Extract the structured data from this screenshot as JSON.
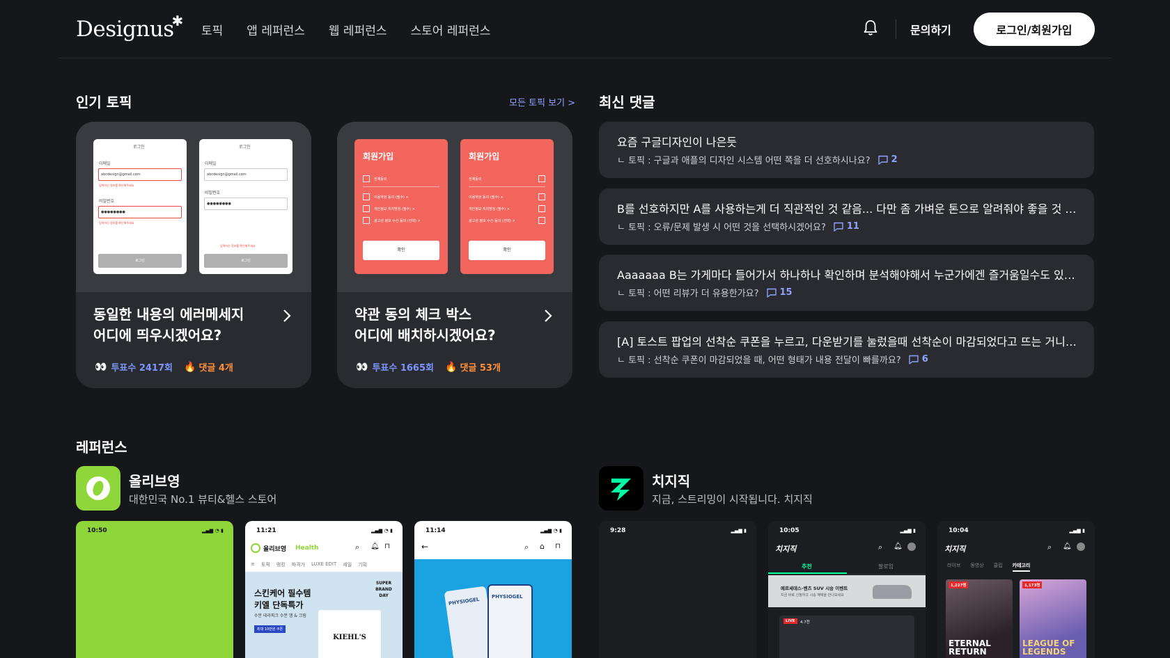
{
  "header": {
    "logo": "Designus",
    "nav": [
      "토픽",
      "앱 레퍼런스",
      "웹 레퍼런스",
      "스토어 레퍼런스"
    ],
    "inquiry": "문의하기",
    "login": "로그인/회원가입"
  },
  "popular": {
    "title": "인기 토픽",
    "see_all": "모든 토픽 보기 >",
    "cards": [
      {
        "title_line1": "동일한 내용의 에러메세지",
        "title_line2": "어디에 띄우시겠어요?",
        "votes": "투표수 2417회",
        "comments": "댓글 4개",
        "mock": {
          "header": "로그인",
          "email_label": "이메일",
          "email_value": "abcdesign@gmail.com",
          "error1": "입력하신 정보를 확인해주세요",
          "pw_label": "비밀번호",
          "pw_value": "●●●●●●●●",
          "error2": "입력하신 정보를 확인해주세요",
          "button": "로그인"
        }
      },
      {
        "title_line1": "약관 동의 체크 박스",
        "title_line2": "어디에 배치하시겠어요?",
        "votes": "투표수 1665회",
        "comments": "댓글 53개",
        "mock": {
          "header": "회원가입",
          "all": "전체동의",
          "item1": "이용약관 동의 (필수) >",
          "item2": "개인정보 처리방침 (필수) >",
          "item3": "광고성 정보 수신 동의 (선택) >",
          "button": "확인"
        }
      }
    ]
  },
  "comments": {
    "title": "최신 댓글",
    "items": [
      {
        "text": "요즘 구글디자인이 나은듯",
        "topic": "ㄴ 토픽 : 구글과 애플의 디자인 시스템 어떤 쪽을 더 선호하시나요?",
        "count": "2"
      },
      {
        "text": "B를 선호하지만 A를 사용하는게 더 직관적인 것 같음... 다만 좀 가벼운 톤으로 알려줘야 좋을 것 같음",
        "topic": "ㄴ 토픽 : 오류/문제 발생 시 어떤 것을 선택하시겠어요?",
        "count": "11"
      },
      {
        "text": "Aaaaaaa B는 가게마다 들어가서 하나하나 확인하며 분석해야해서 누군가에겐 즐거움일수도 있지...",
        "topic": "ㄴ 토픽 : 어떤 리뷰가 더 유용한가요?",
        "count": "15"
      },
      {
        "text": "[A] 토스트 팝업의 선착순 쿠폰을 누르고, 다운받기를 눌렀을때 선착순이 마감되었다고 뜨는 거니까,...",
        "topic": "ㄴ 토픽 : 선착순 쿠폰이 마감되었을 때, 어떤 형태가 내용 전달이 빠를까요?",
        "count": "6"
      }
    ]
  },
  "references": {
    "title": "레퍼런스",
    "apps": [
      {
        "name": "올리브영",
        "desc": "대한민국 No.1 뷰티&헬스 스토어",
        "icon": "olive-young-logo",
        "accent": "#8fd63a",
        "screens": [
          {
            "time": "10:50"
          },
          {
            "time": "11:21",
            "brand": "올리브영",
            "brand_sub": "Health",
            "tabs": [
              "토픽",
              "랭킹",
              "파격가",
              "LUXE EDIT",
              "세일",
              "기획"
            ],
            "promo1": "스킨케어 필수템",
            "promo2": "키엘 단독특가",
            "promo3": "수분 테라피크 수분 앰 & 크림",
            "promo_tag": "최대 10만원 쿠폰",
            "badge": "SUPER BRAND DAY",
            "product": "KIEHL'S"
          },
          {
            "time": "11:14",
            "product": "PHYSIOGEL"
          }
        ]
      },
      {
        "name": "치지직",
        "desc": "지금, 스트리밍이 시작됩니다. 치지직",
        "icon": "chzzk-logo",
        "accent": "#00ffa3",
        "screens": [
          {
            "time": "9:28"
          },
          {
            "time": "10:05",
            "brand": "치지직",
            "tabs": [
              "추천",
              "팔로잉"
            ],
            "ad": "메르세데스-벤츠 SUV 시승 이벤트",
            "ad_sub": "지금 바로 신청하고 시승 혜택을 만나보세요",
            "live": "LIVE",
            "live_count": "4.7천"
          },
          {
            "time": "10:04",
            "brand": "치지직",
            "tabs": [
              "라이브",
              "동영상",
              "클립",
              "카테고리"
            ],
            "card1": "1,227명",
            "card2": "1,173명",
            "game1": "ETERNAL RETURN",
            "game2": "LEAGUE OF LEGENDS"
          }
        ]
      }
    ]
  }
}
